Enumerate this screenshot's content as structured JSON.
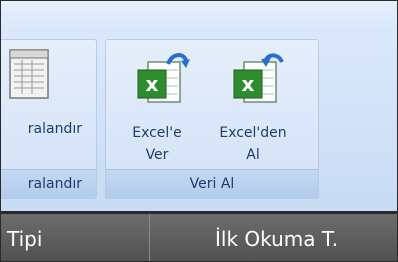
{
  "ribbon": {
    "group_left": {
      "command_label": "ralandır",
      "group_label": "ralandır"
    },
    "group_data": {
      "group_label": "Veri Al",
      "excel_export": {
        "line1": "Excel'e",
        "line2": "Ver"
      },
      "excel_import": {
        "line1": "Excel'den",
        "line2": "Al"
      }
    }
  },
  "grid_header": {
    "col1": "Tipi",
    "col2": "İlk Okuma T."
  },
  "colors": {
    "accent": "#1e3d6d",
    "excel_green": "#2e8b2e",
    "arrow_blue": "#2a6fc9"
  },
  "icons": [
    "report-icon",
    "excel-export-icon",
    "excel-import-icon"
  ]
}
